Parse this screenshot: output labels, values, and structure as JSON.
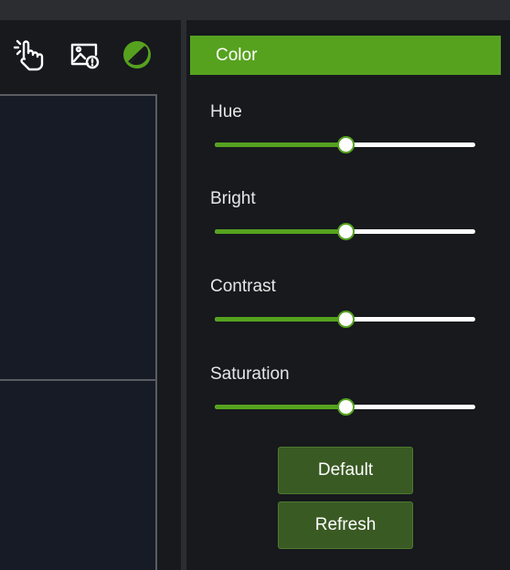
{
  "colors": {
    "accent": "#56a21f",
    "panel_bg": "#17191d",
    "button_bg": "#3a5a24",
    "track": "#ffffff"
  },
  "toolbar": {
    "icons": [
      "touch-hand-icon",
      "image-alert-icon",
      "color-adjust-icon"
    ]
  },
  "panel": {
    "title": "Color",
    "sliders": [
      {
        "label": "Hue",
        "value": 0.5
      },
      {
        "label": "Bright",
        "value": 0.5
      },
      {
        "label": "Contrast",
        "value": 0.5
      },
      {
        "label": "Saturation",
        "value": 0.5
      }
    ],
    "default_label": "Default",
    "refresh_label": "Refresh"
  }
}
